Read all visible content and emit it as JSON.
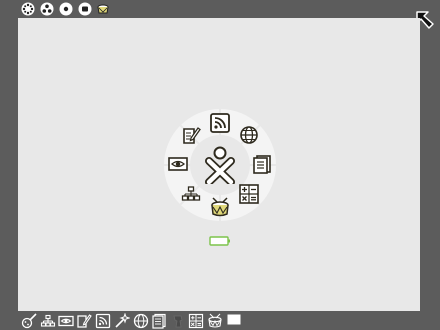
{
  "frame": {
    "top_icons": [
      {
        "name": "settings-dots-icon"
      },
      {
        "name": "network-neighborhood-icon"
      },
      {
        "name": "home-view-icon"
      },
      {
        "name": "activity-view-icon"
      },
      {
        "name": "journal-drum-icon"
      }
    ],
    "corner_icon": "arrow-up-left-icon",
    "bottom_icons": [
      {
        "name": "paint-icon"
      },
      {
        "name": "turtle-blocks-icon"
      },
      {
        "name": "observe-eye-icon"
      },
      {
        "name": "write-icon"
      },
      {
        "name": "rss-reader-icon"
      },
      {
        "name": "magic-wand-icon"
      },
      {
        "name": "browse-globe-icon"
      },
      {
        "name": "read-document-icon"
      },
      {
        "name": "disabled-activity-icon"
      },
      {
        "name": "calculate-icon"
      },
      {
        "name": "tamtam-drum-icon"
      },
      {
        "name": "terminal-window-icon"
      }
    ]
  },
  "home_ring": {
    "center_icon": "xo-person-icon",
    "activities": [
      {
        "name": "rss-reader-icon"
      },
      {
        "name": "browse-globe-icon"
      },
      {
        "name": "read-document-icon"
      },
      {
        "name": "calculate-icon"
      },
      {
        "name": "tamtam-drum-icon"
      },
      {
        "name": "turtle-blocks-icon"
      },
      {
        "name": "observe-eye-icon"
      },
      {
        "name": "write-icon"
      }
    ]
  },
  "battery": {
    "icon": "battery-icon",
    "color": "#7cc44a"
  },
  "colors": {
    "frame": "#5c5c5c",
    "desktop": "#e8e8e8",
    "ring": "#f4f4f4",
    "icon_stroke": "#2e2a1e",
    "icon_fill": "#ffffff",
    "accent_green": "#7cc44a"
  }
}
